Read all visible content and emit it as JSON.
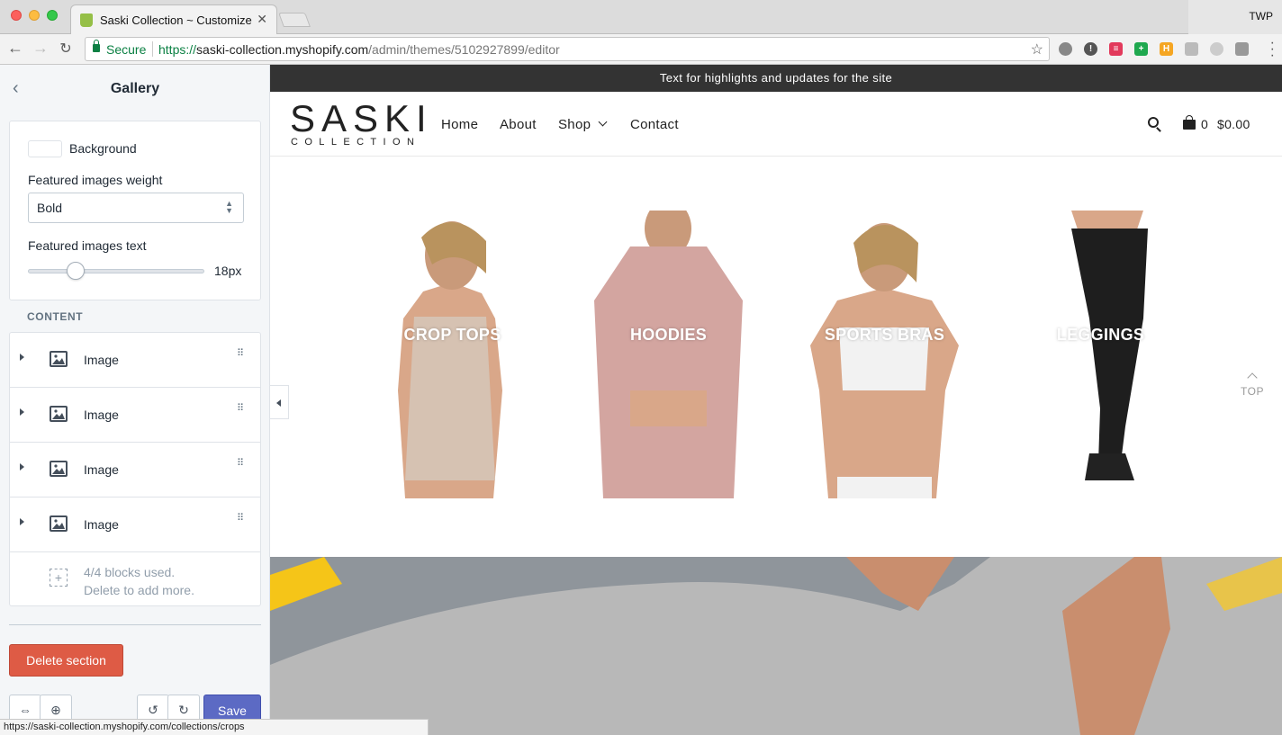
{
  "browser": {
    "tab_title": "Saski Collection ~ Customize ~",
    "profile": "TWP",
    "secure_label": "Secure",
    "url_scheme": "https://",
    "url_host": "saski-collection.myshopify.com",
    "url_path": "/admin/themes/5102927899/editor",
    "status_url": "https://saski-collection.myshopify.com/collections/crops"
  },
  "sidebar": {
    "title": "Gallery",
    "background_label": "Background",
    "weight_label": "Featured images weight",
    "weight_value": "Bold",
    "text_label": "Featured images text",
    "text_value": "18px",
    "text_size_px": 18,
    "content_heading": "CONTENT",
    "blocks": [
      {
        "label": "Image"
      },
      {
        "label": "Image"
      },
      {
        "label": "Image"
      },
      {
        "label": "Image"
      }
    ],
    "blocks_used_line1": "4/4 blocks used.",
    "blocks_used_line2": "Delete to add more.",
    "delete_label": "Delete section",
    "save_label": "Save"
  },
  "store": {
    "announcement": "Text for highlights and updates for the site",
    "logo_main": "SASKI",
    "logo_sub": "COLLECTION",
    "nav": [
      "Home",
      "About",
      "Shop",
      "Contact"
    ],
    "cart_count": "0",
    "cart_total": "$0.00",
    "gallery": [
      {
        "caption": "CROP TOPS",
        "garment_color": "#d6c2b2"
      },
      {
        "caption": "HOODIES",
        "garment_color": "#d3a5a0"
      },
      {
        "caption": "SPORTS BRAS",
        "garment_color": "#f2f2f2"
      },
      {
        "caption": "LEGGINGS",
        "garment_color": "#1e1e1e"
      }
    ],
    "top_label": "TOP"
  },
  "colors": {
    "save": "#5c6ac4",
    "delete": "#de5b45",
    "announcement_bg": "#333333",
    "secure_green": "#0b8043"
  }
}
